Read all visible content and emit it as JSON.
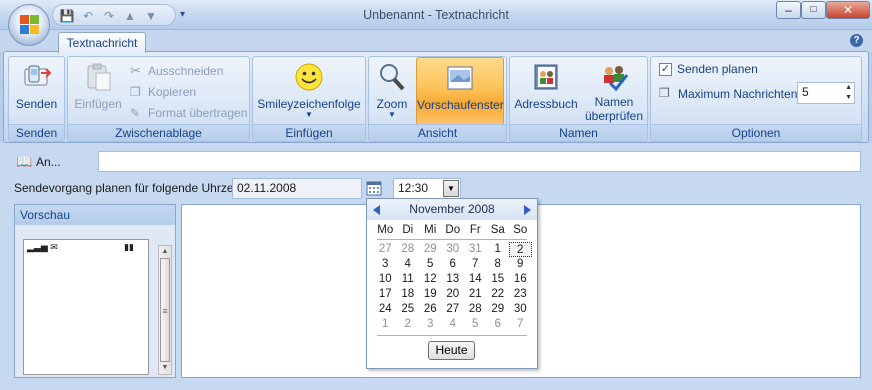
{
  "window": {
    "title": "Unbenannt - Textnachricht"
  },
  "ribbon": {
    "tab": "Textnachricht",
    "groups": {
      "senden": {
        "label": "Senden",
        "send_button": "Senden"
      },
      "zwischenablage": {
        "label": "Zwischenablage",
        "paste": "Einfügen",
        "cut": "Ausschneiden",
        "copy": "Kopieren",
        "format_painter": "Format übertragen"
      },
      "einfuegen": {
        "label": "Einfügen",
        "smiley": "Smileyzeichenfolge"
      },
      "ansicht": {
        "label": "Ansicht",
        "zoom": "Zoom",
        "preview": "Vorschaufenster"
      },
      "namen": {
        "label": "Namen",
        "addressbook": "Adressbuch",
        "check_names_1": "Namen",
        "check_names_2": "überprüfen"
      },
      "optionen": {
        "label": "Optionen",
        "schedule_send": "Senden planen",
        "max_messages_label": "Maximum Nachrichten:",
        "max_messages_value": "5"
      }
    }
  },
  "form": {
    "to_button": "An...",
    "to_value": "",
    "schedule_label": "Sendevorgang planen für folgende Uhrzeit:",
    "date_value": "02.11.2008",
    "time_value": "12:30"
  },
  "preview": {
    "label": "Vorschau"
  },
  "calendar": {
    "month": "November 2008",
    "weekdays": [
      "Mo",
      "Di",
      "Mi",
      "Do",
      "Fr",
      "Sa",
      "So"
    ],
    "weeks": [
      [
        "27",
        "28",
        "29",
        "30",
        "31",
        "1",
        "2"
      ],
      [
        "3",
        "4",
        "5",
        "6",
        "7",
        "8",
        "9"
      ],
      [
        "10",
        "11",
        "12",
        "13",
        "14",
        "15",
        "16"
      ],
      [
        "17",
        "18",
        "19",
        "20",
        "21",
        "22",
        "23"
      ],
      [
        "24",
        "25",
        "26",
        "27",
        "28",
        "29",
        "30"
      ],
      [
        "1",
        "2",
        "3",
        "4",
        "5",
        "6",
        "7"
      ]
    ],
    "today_button": "Heute"
  },
  "colors": {
    "accent": "#15428b",
    "ribbon_bg": "#cfdff3",
    "preview_active": "#fcc35a"
  }
}
